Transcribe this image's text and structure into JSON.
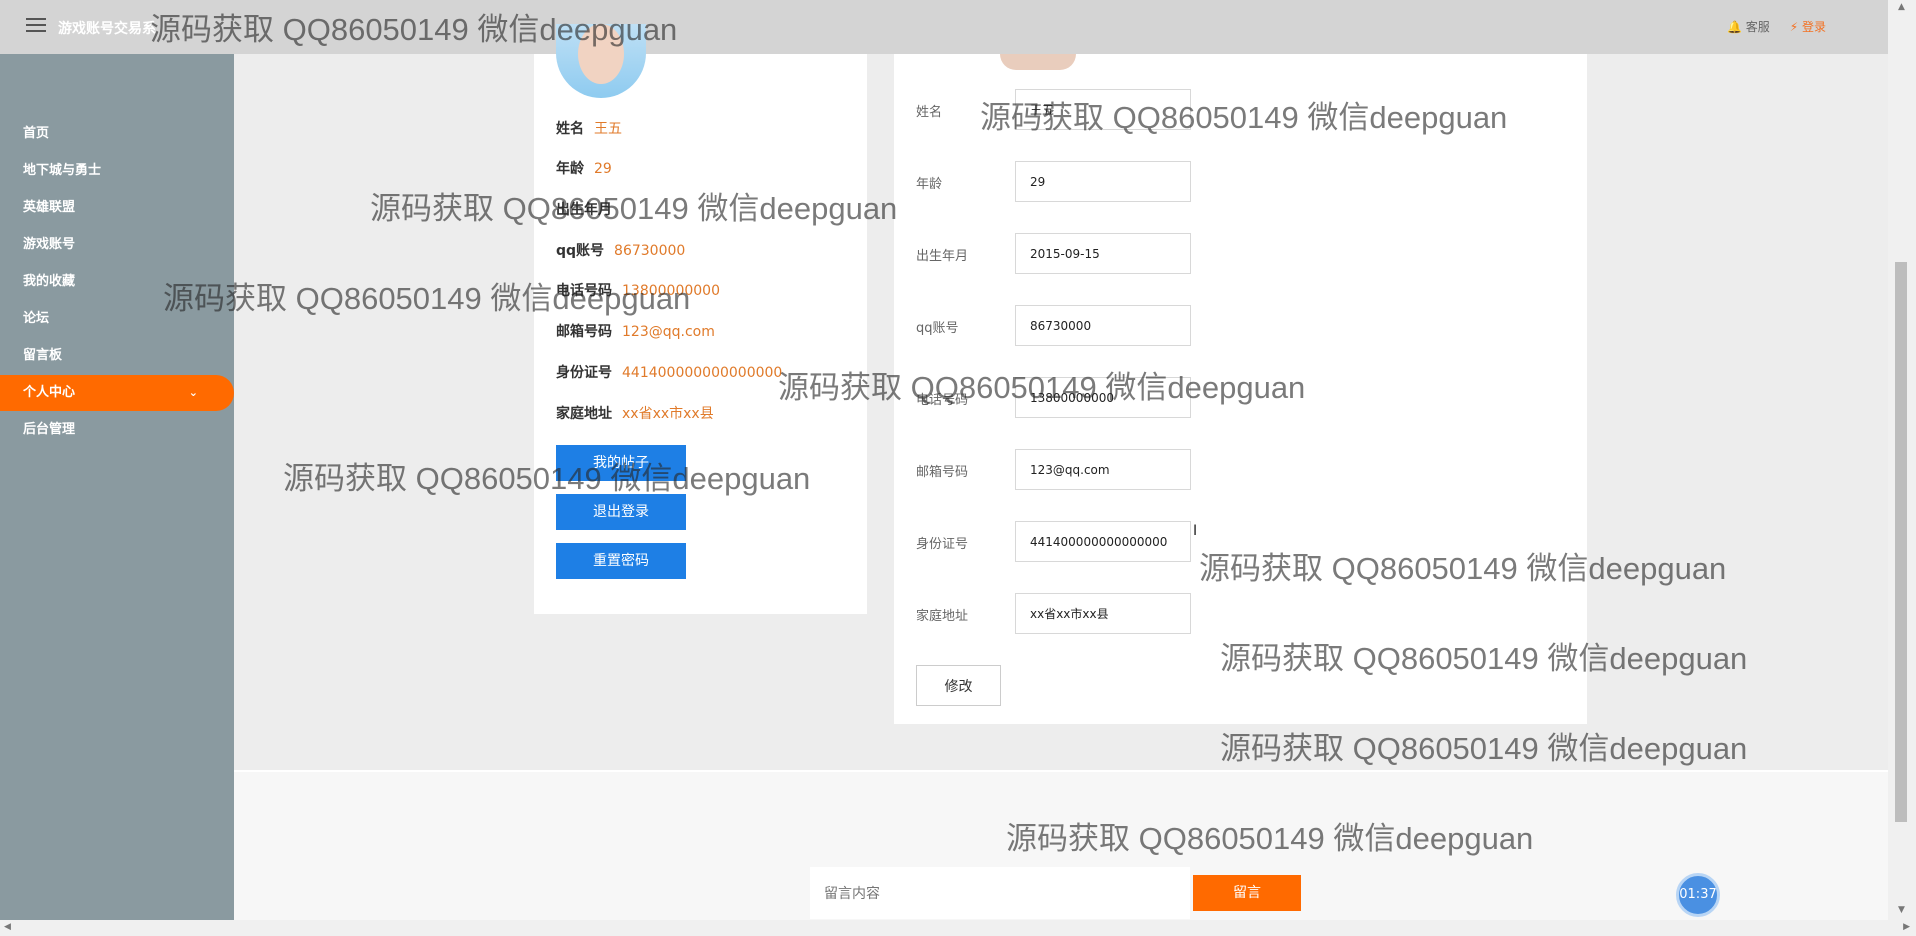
{
  "header": {
    "app_title": "游戏账号交易系",
    "service_label": "🔔 客服",
    "login_label": "⚡ 登录"
  },
  "sidebar": {
    "items": [
      {
        "label": "首页"
      },
      {
        "label": "地下城与勇士"
      },
      {
        "label": "英雄联盟"
      },
      {
        "label": "游戏账号"
      },
      {
        "label": "我的收藏"
      },
      {
        "label": "论坛"
      },
      {
        "label": "留言板"
      },
      {
        "label": "个人中心",
        "active": true
      },
      {
        "label": "后台管理"
      }
    ]
  },
  "profile_card": {
    "rows": [
      {
        "label": "姓名",
        "value": "王五"
      },
      {
        "label": "年龄",
        "value": "29"
      },
      {
        "label": "出生年月",
        "value": ""
      },
      {
        "label": "qq账号",
        "value": "86730000"
      },
      {
        "label": "电话号码",
        "value": "13800000000"
      },
      {
        "label": "邮箱号码",
        "value": "123@qq.com"
      },
      {
        "label": "身份证号",
        "value": "441400000000000000"
      },
      {
        "label": "家庭地址",
        "value": "xx省xx市xx县"
      }
    ],
    "buttons": {
      "my_posts": "我的帖子",
      "logout": "退出登录",
      "reset_password": "重置密码"
    }
  },
  "edit_form": {
    "fields": [
      {
        "label": "姓名",
        "value": "王五"
      },
      {
        "label": "年龄",
        "value": "29"
      },
      {
        "label": "出生年月",
        "value": "2015-09-15"
      },
      {
        "label": "qq账号",
        "value": "86730000"
      },
      {
        "label": "电话号码",
        "value": "13800000000"
      },
      {
        "label": "邮箱号码",
        "value": "123@qq.com"
      },
      {
        "label": "身份证号",
        "value": "441400000000000000"
      },
      {
        "label": "家庭地址",
        "value": "xx省xx市xx县"
      }
    ],
    "submit_label": "修改"
  },
  "message_box": {
    "placeholder": "留言内容",
    "button_label": "留言"
  },
  "timer": "01:37",
  "watermark_text": "源码获取 QQ86050149 微信deepguan",
  "colors": {
    "accent": "#ff6a00",
    "primary_button": "#1e7fe5",
    "sidebar_bg": "#8a9aa0",
    "value_text": "#e07a2a"
  }
}
